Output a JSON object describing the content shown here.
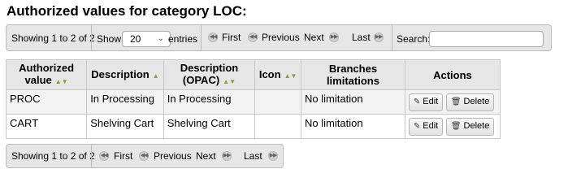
{
  "page": {
    "title": "Authorized values for category LOC:"
  },
  "pager_top": {
    "info": "Showing 1 to 2 of 2",
    "show_label": "Show",
    "page_size": "20",
    "entries_label": "entries",
    "first": "First",
    "previous": "Previous",
    "next": "Next",
    "last": "Last",
    "search_label": "Search:",
    "search_value": ""
  },
  "table": {
    "headers": [
      "Authorized value",
      "Description",
      "Description (OPAC)",
      "Icon",
      "Branches limitations",
      "Actions"
    ],
    "rows": [
      {
        "value": "PROC",
        "description": "In Processing",
        "opac": "In Processing",
        "icon": "",
        "branches": "No limitation",
        "edit": "Edit",
        "delete": "Delete"
      },
      {
        "value": "CART",
        "description": "Shelving Cart",
        "opac": "Shelving Cart",
        "icon": "",
        "branches": "No limitation",
        "edit": "Edit",
        "delete": "Delete"
      }
    ]
  },
  "pager_bottom": {
    "info": "Showing 1 to 2 of 2",
    "first": "First",
    "previous": "Previous",
    "next": "Next",
    "last": "Last"
  },
  "icons": {
    "sort_both": "sort-arrows-icon",
    "sort_asc": "sort-up-icon",
    "edit": "pencil-icon",
    "delete": "trash-icon",
    "first": "rewind-icon",
    "previous": "rewind-icon",
    "next": "fast-forward-icon",
    "last": "fast-forward-icon"
  }
}
